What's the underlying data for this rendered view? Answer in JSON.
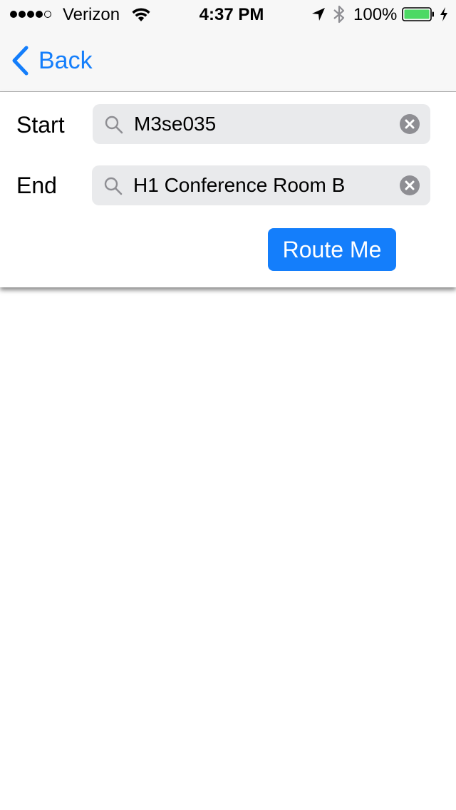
{
  "status_bar": {
    "carrier": "Verizon",
    "signal_bars_filled": 4,
    "signal_bars_total": 5,
    "time": "4:37 PM",
    "battery_percent": "100%",
    "icons": [
      "wifi-icon",
      "location-arrow-icon",
      "bluetooth-icon",
      "battery-icon",
      "charging-bolt-icon"
    ]
  },
  "nav": {
    "back_label": "Back"
  },
  "form": {
    "start_label": "Start",
    "start_value": "M3se035",
    "end_label": "End",
    "end_value": "H1 Conference Room B",
    "route_button_label": "Route Me"
  },
  "colors": {
    "accent": "#147efb",
    "field_background": "#e9eaec",
    "bar_background": "#f7f7f7",
    "battery_fill": "#4cd964"
  }
}
